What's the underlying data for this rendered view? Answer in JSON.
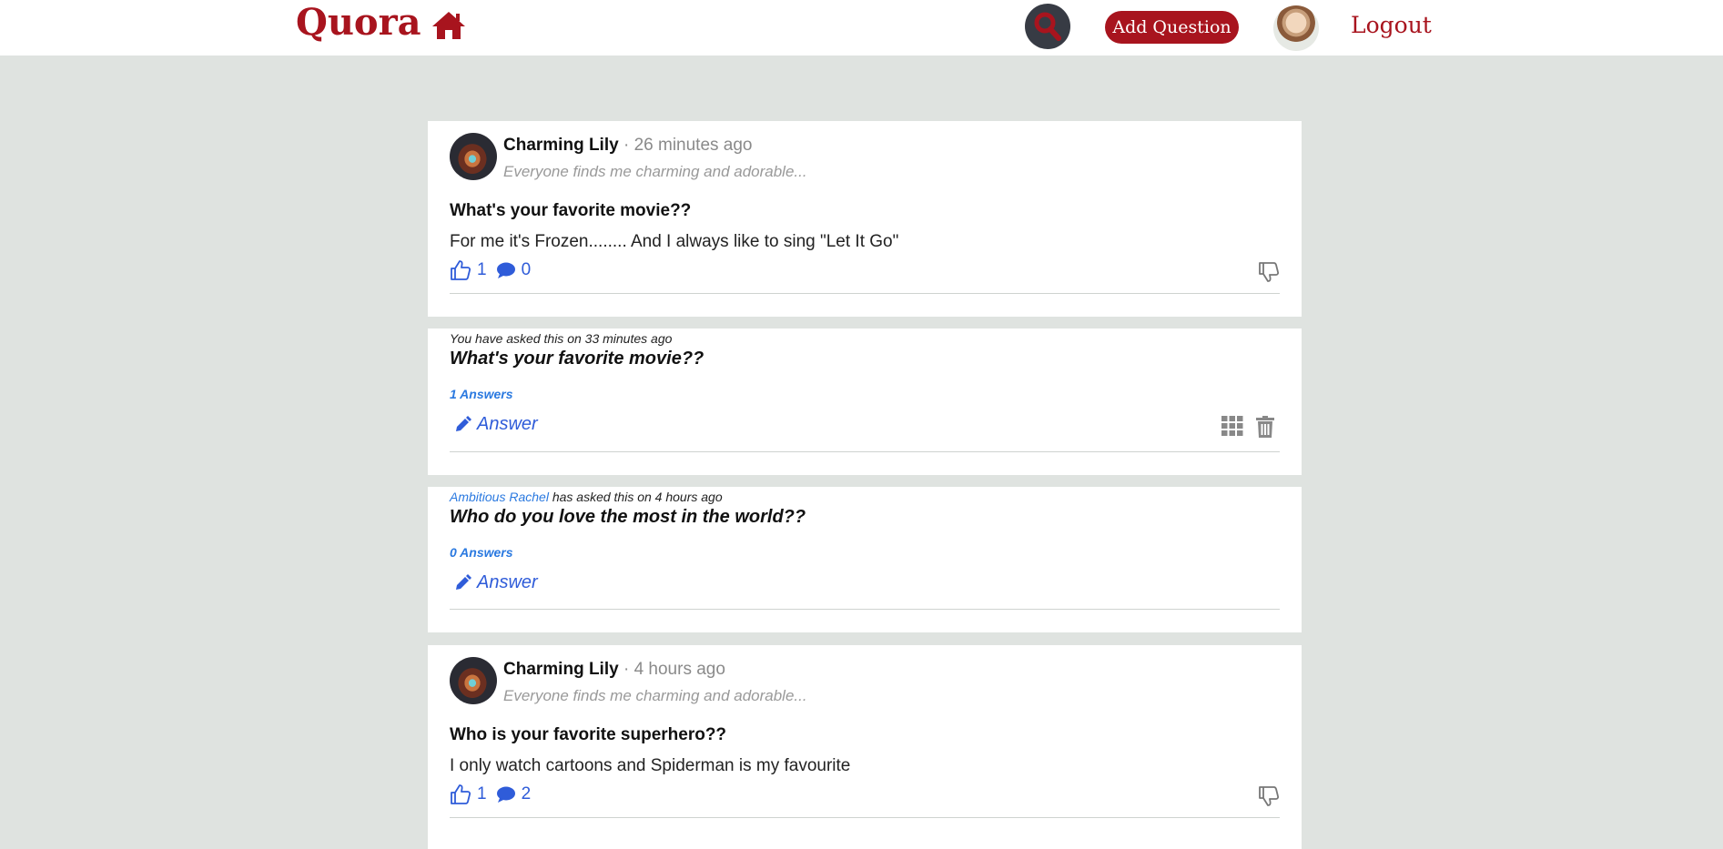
{
  "header": {
    "logo": "Quora",
    "add_question_label": "Add Question",
    "logout_label": "Logout",
    "brand_color": "#a8141e",
    "icons": [
      "home-icon",
      "search-icon",
      "avatar"
    ]
  },
  "posts": [
    {
      "type": "answer",
      "user": "Charming Lily",
      "time": "26 minutes ago",
      "tagline": "Everyone finds me charming and adorable...",
      "question": "What's your favorite movie??",
      "answer": "For me it's Frozen........ And I always like to sing \"Let It Go\"",
      "likes": "1",
      "comments": "0"
    },
    {
      "type": "question",
      "asked_prefix": "You have asked this on 33 minutes ago",
      "question": "What's your favorite movie??",
      "answers_count": "1 Answers",
      "answer_label": "Answer"
    },
    {
      "type": "question",
      "asker": "Ambitious Rachel",
      "asked_suffix": "has asked this on 4 hours ago",
      "question": "Who do you love the most in the world??",
      "answers_count": "0 Answers",
      "answer_label": "Answer"
    },
    {
      "type": "answer",
      "user": "Charming Lily",
      "time": "4 hours ago",
      "tagline": "Everyone finds me charming and adorable...",
      "question": "Who is your favorite superhero??",
      "answer": "I only watch cartoons and Spiderman is my favourite",
      "likes": "1",
      "comments": "2"
    }
  ]
}
